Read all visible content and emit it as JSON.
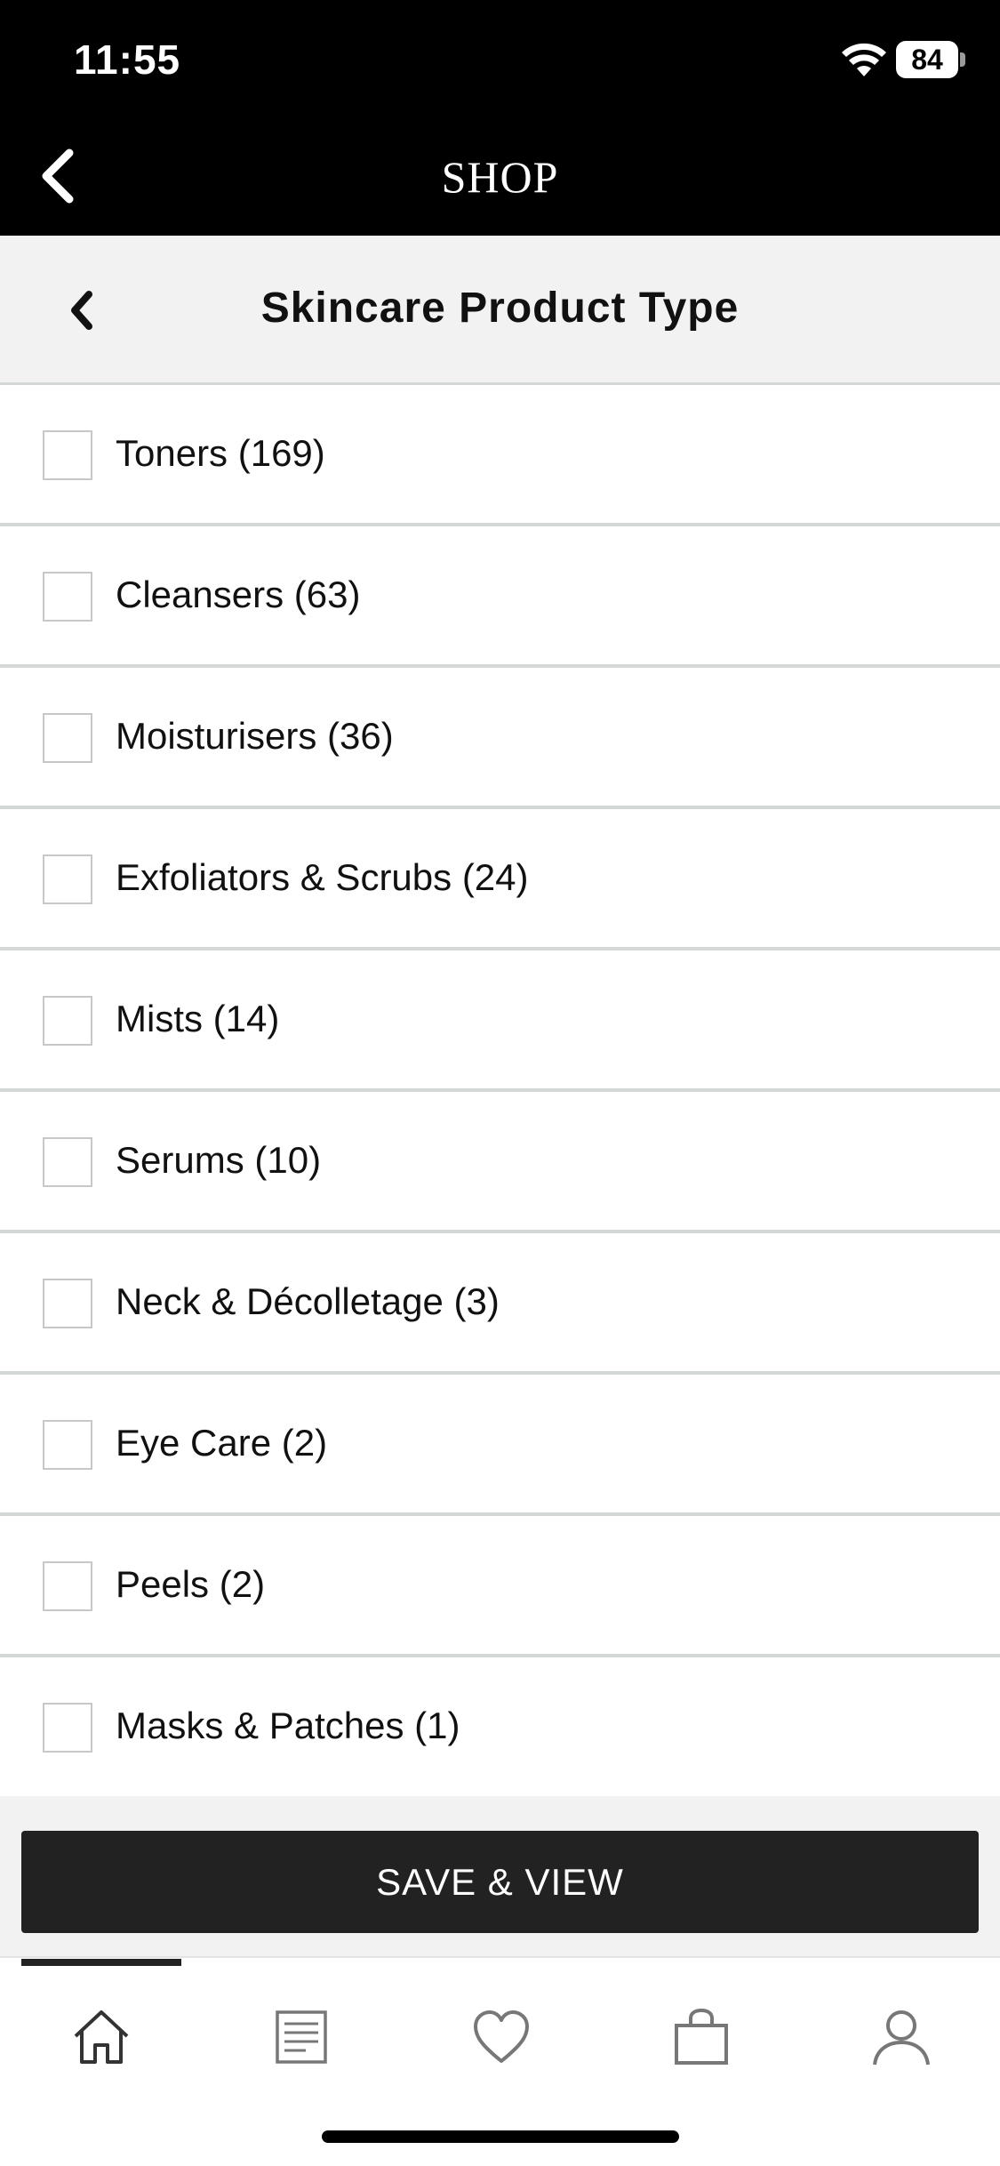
{
  "status_bar": {
    "time": "11:55",
    "battery": "84",
    "icons": [
      "wifi-icon",
      "battery-icon"
    ]
  },
  "header": {
    "title": "SHOP",
    "back_icon": "chevron-left-icon"
  },
  "subheader": {
    "title": "Skincare Product Type",
    "back_icon": "chevron-left-icon"
  },
  "filters": {
    "items": [
      {
        "label": "Toners (169)",
        "checked": false
      },
      {
        "label": "Cleansers (63)",
        "checked": false
      },
      {
        "label": "Moisturisers (36)",
        "checked": false
      },
      {
        "label": "Exfoliators & Scrubs (24)",
        "checked": false
      },
      {
        "label": "Mists (14)",
        "checked": false
      },
      {
        "label": "Serums (10)",
        "checked": false
      },
      {
        "label": "Neck & Décolletage (3)",
        "checked": false
      },
      {
        "label": "Eye Care (2)",
        "checked": false
      },
      {
        "label": "Peels (2)",
        "checked": false
      },
      {
        "label": "Masks & Patches (1)",
        "checked": false
      }
    ]
  },
  "action": {
    "save_label": "SAVE & VIEW"
  },
  "tabbar": {
    "active_tab": "home",
    "tabs": [
      "home-icon",
      "catalog-icon",
      "heart-icon",
      "bag-icon",
      "profile-icon"
    ]
  },
  "colors": {
    "header_bg": "#000000",
    "subheader_bg": "#f2f2f2",
    "divider": "#d3d7d8",
    "button_bg": "#222222"
  }
}
